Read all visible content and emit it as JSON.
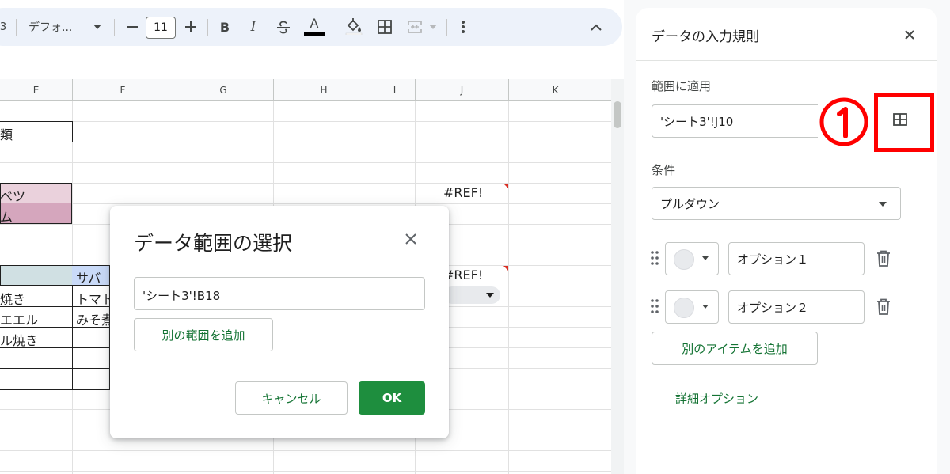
{
  "toolbar": {
    "cell_ref_fragment": "3",
    "font_name": "デフォ...",
    "font_size": "11",
    "minus": "—",
    "plus": "+",
    "bold": "B",
    "italic": "I",
    "font_color_letter": "A"
  },
  "sheet": {
    "columns": [
      "E",
      "F",
      "G",
      "H",
      "I",
      "J",
      "K"
    ],
    "cells": {
      "e_r2": "類",
      "e_r5": "ベツ",
      "e_r6": "ム",
      "f_r8": "サバ",
      "e_r9": "焼き",
      "f_r9": "トマト",
      "e_r10": "エエル",
      "f_r10": "みそ煮",
      "e_r11": "ル焼き",
      "j_r5": "#REF!",
      "j_r8": "#REF!"
    }
  },
  "dialog": {
    "title": "データ範囲の選択",
    "range_value": "'シート3'!B18",
    "add_range_label": "別の範囲を追加",
    "cancel_label": "キャンセル",
    "ok_label": "OK"
  },
  "panel": {
    "title": "データの入力規則",
    "apply_label": "範囲に適用",
    "apply_value": "'シート3'!J10",
    "annotation": "①",
    "condition_label": "条件",
    "condition_value": "プルダウン",
    "options": [
      {
        "value": "オプション１"
      },
      {
        "value": "オプション２"
      }
    ],
    "add_item_label": "別のアイテムを追加",
    "advanced_label": "詳細オプション"
  },
  "colors": {
    "accent_green": "#1e8e3e",
    "link_green": "#137333",
    "annotation_red": "#ff0000",
    "cell_pink": "#ead1dc",
    "cell_pink_dark": "#d5a6bd",
    "cell_blue": "#c9daf8",
    "cell_blue_gray": "#d0e0e3"
  }
}
